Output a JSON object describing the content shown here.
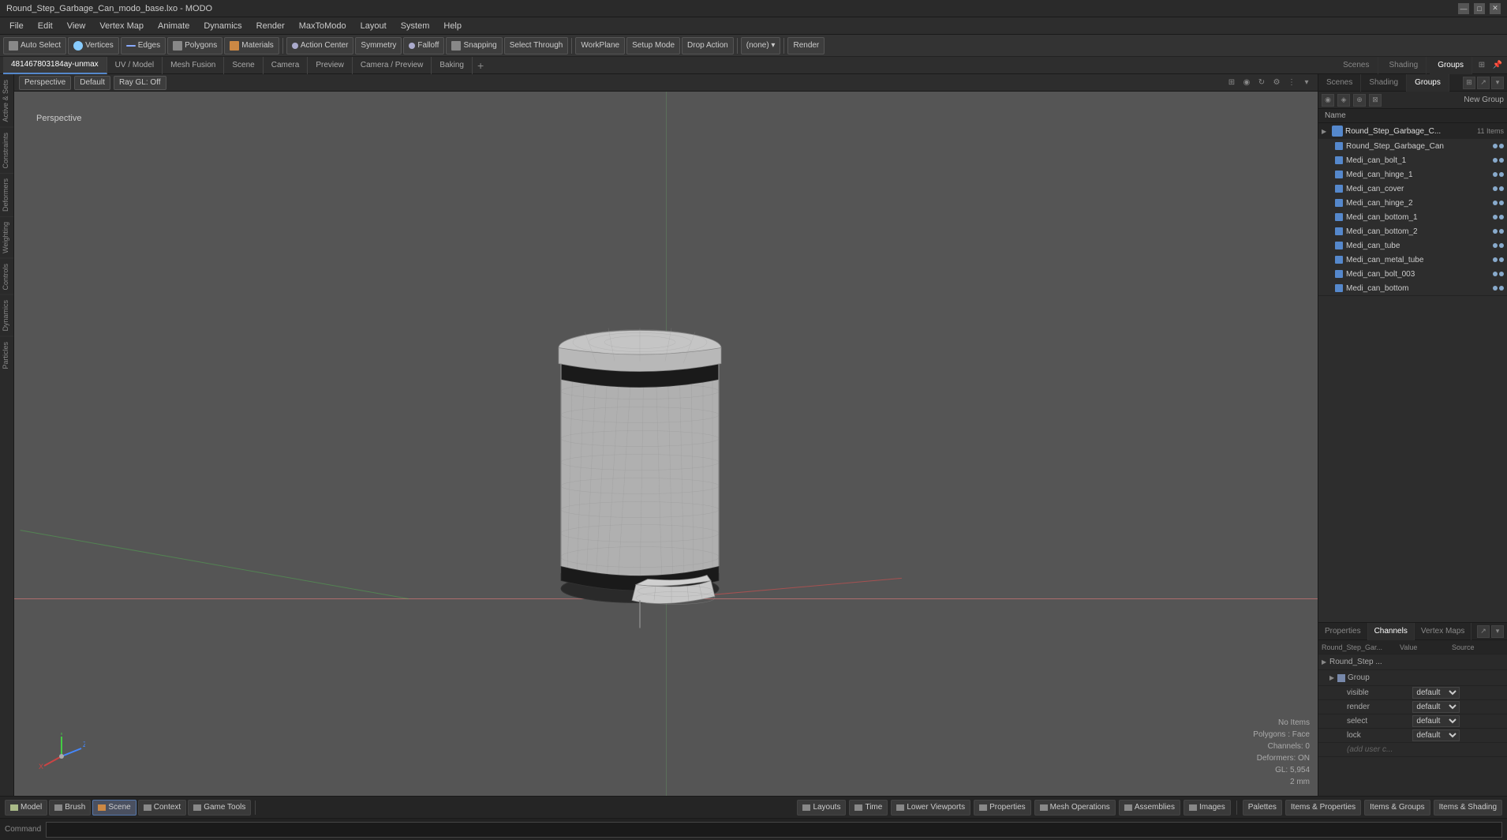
{
  "titlebar": {
    "title": "Round_Step_Garbage_Can_modo_base.lxo - MODO",
    "controls": [
      "—",
      "□",
      "✕"
    ]
  },
  "menubar": {
    "items": [
      "File",
      "Edit",
      "View",
      "Vertex Map",
      "Animate",
      "Dynamics",
      "Render",
      "MaxToModo",
      "Layout",
      "System",
      "Help"
    ]
  },
  "toolbar": {
    "buttons": [
      {
        "label": "Auto Select",
        "active": false
      },
      {
        "label": "Vertices",
        "active": false
      },
      {
        "label": "Edges",
        "active": false
      },
      {
        "label": "Polygons",
        "active": false
      },
      {
        "label": "Materials",
        "active": false
      },
      {
        "label": "Action Center",
        "active": false
      },
      {
        "label": "Symmetry",
        "active": false
      },
      {
        "label": "Falloff",
        "active": false
      },
      {
        "label": "Snapping",
        "active": false
      },
      {
        "label": "Select Through",
        "active": false
      },
      {
        "label": "WorkPlane",
        "active": false
      },
      {
        "label": "Setup Mode",
        "active": false
      },
      {
        "label": "Drop Action",
        "active": false
      },
      {
        "label": "(none)",
        "active": false
      },
      {
        "label": "Render",
        "active": false
      }
    ]
  },
  "tabbar": {
    "tabs": [
      {
        "label": "481467803184ay-unmax",
        "active": true
      },
      {
        "label": "UV / Model",
        "active": false
      },
      {
        "label": "Mesh Fusion",
        "active": false
      },
      {
        "label": "Scene",
        "active": false
      },
      {
        "label": "Camera",
        "active": false
      },
      {
        "label": "Preview",
        "active": false
      },
      {
        "label": "Camera / Preview",
        "active": false
      },
      {
        "label": "Baking",
        "active": false
      }
    ],
    "right_tabs": [
      "Scenes",
      "Shading",
      "Groups"
    ]
  },
  "viewport": {
    "view_type": "Perspective",
    "shading": "Default",
    "ray_gl": "Ray GL: Off",
    "info": {
      "no_items": "No Items",
      "polygons": "Polygons : Face",
      "channels": "Channels: 0",
      "deformers": "Deformers: ON",
      "gl": "GL: 5,954",
      "size": "2 mm"
    }
  },
  "left_sidebar": {
    "tabs": [
      "Active & Sets",
      "Constraints",
      "Deformers",
      "Weighting",
      "Controls",
      "Dynamics",
      "Particles"
    ]
  },
  "right_panel": {
    "top_tabs": [
      "Scenes",
      "Shading",
      "Groups"
    ],
    "active_tab": "Groups",
    "new_group_label": "New Group",
    "name_header": "Name",
    "group": {
      "name": "Round_Step_Garbage_C...",
      "count": "11 Items",
      "items": [
        {
          "name": "Round_Step_Garbage_Can",
          "selected": false
        },
        {
          "name": "Medi_can_bolt_1",
          "selected": false
        },
        {
          "name": "Medi_can_hinge_1",
          "selected": false
        },
        {
          "name": "Medi_can_cover",
          "selected": false
        },
        {
          "name": "Medi_can_hinge_2",
          "selected": false
        },
        {
          "name": "Medi_can_bottom_1",
          "selected": false
        },
        {
          "name": "Medi_can_bottom_2",
          "selected": false
        },
        {
          "name": "Medi_can_tube",
          "selected": false
        },
        {
          "name": "Medi_can_metal_tube",
          "selected": false
        },
        {
          "name": "Medi_can_bolt_003",
          "selected": false
        },
        {
          "name": "Medi_can_bottom",
          "selected": false
        }
      ]
    }
  },
  "properties_panel": {
    "tabs": [
      "Properties",
      "Channels",
      "Vertex Maps"
    ],
    "active_tab": "Channels",
    "header": {
      "name": "Round_Step_Gar...",
      "value": "Value",
      "source": "Source"
    },
    "tree_items": [
      {
        "label": "Round_Step ...",
        "indent": 0,
        "expanded": true
      },
      {
        "label": "Group",
        "indent": 1,
        "expanded": true
      }
    ],
    "rows": [
      {
        "name": "visible",
        "value": "default",
        "source": ""
      },
      {
        "name": "render",
        "value": "default",
        "source": ""
      },
      {
        "name": "select",
        "value": "default",
        "source": ""
      },
      {
        "name": "lock",
        "value": "default",
        "source": ""
      },
      {
        "name": "(add user c...",
        "value": "",
        "source": ""
      }
    ]
  },
  "bottom_bar": {
    "buttons": [
      {
        "label": "Model",
        "active": false
      },
      {
        "label": "Brush",
        "active": false
      },
      {
        "label": "Scene",
        "active": true
      },
      {
        "label": "Context",
        "active": false
      },
      {
        "label": "Game Tools",
        "active": false
      }
    ],
    "right_buttons": [
      {
        "label": "Layouts"
      },
      {
        "label": "Time"
      },
      {
        "label": "Lower Viewports"
      },
      {
        "label": "Properties"
      },
      {
        "label": "Mesh Operations"
      },
      {
        "label": "Assemblies"
      },
      {
        "label": "Images"
      }
    ],
    "far_right": [
      "Palettes",
      "Items & Properties",
      "Items & Groups",
      "Items & Shading"
    ]
  },
  "command_bar": {
    "label": "Command",
    "placeholder": ""
  }
}
